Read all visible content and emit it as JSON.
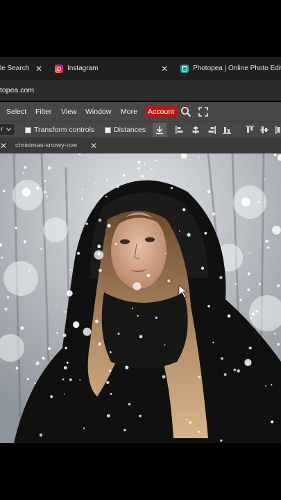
{
  "browser_tabs": [
    {
      "label": "le Search"
    },
    {
      "label": "Instagram"
    },
    {
      "label": "Photopea | Online Photo Editor"
    }
  ],
  "address_bar": {
    "url": "topea.com"
  },
  "menu": {
    "items": [
      "Select",
      "Filter",
      "View",
      "Window",
      "More"
    ],
    "account_label": "Account"
  },
  "options": {
    "dropdown_value": "r",
    "transform_controls_label": "Transform controls",
    "distances_label": "Distances"
  },
  "document": {
    "tab_name": "christmas-snowy-ove"
  },
  "colors": {
    "account_accent": "#b01a1a",
    "menu_bg": "#474747"
  }
}
